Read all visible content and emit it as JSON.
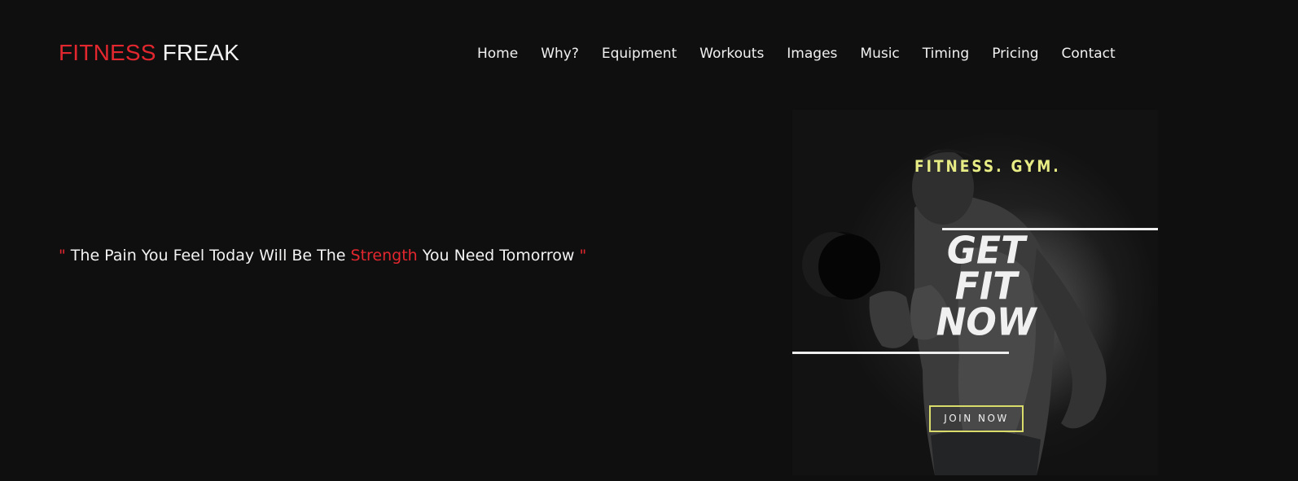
{
  "logo": {
    "part1": "FITNESS",
    "part2": "FREAK"
  },
  "nav": {
    "items": [
      "Home",
      "Why?",
      "Equipment",
      "Workouts",
      "Images",
      "Music",
      "Timing",
      "Pricing",
      "Contact"
    ]
  },
  "quote": {
    "open_mark": "\"",
    "before": " The Pain You Feel Today Will Be The ",
    "highlight": "Strength",
    "after": " You Need Tomorrow ",
    "close_mark": "\""
  },
  "poster": {
    "tagline": "FITNESS. GYM.",
    "headline": [
      "GET",
      "FIT",
      "NOW"
    ],
    "cta": "JOIN NOW"
  },
  "colors": {
    "background": "#0f0f10",
    "accent_red": "#e3272e",
    "poster_yellow": "#e7ec84",
    "text": "#f2f2f2"
  }
}
